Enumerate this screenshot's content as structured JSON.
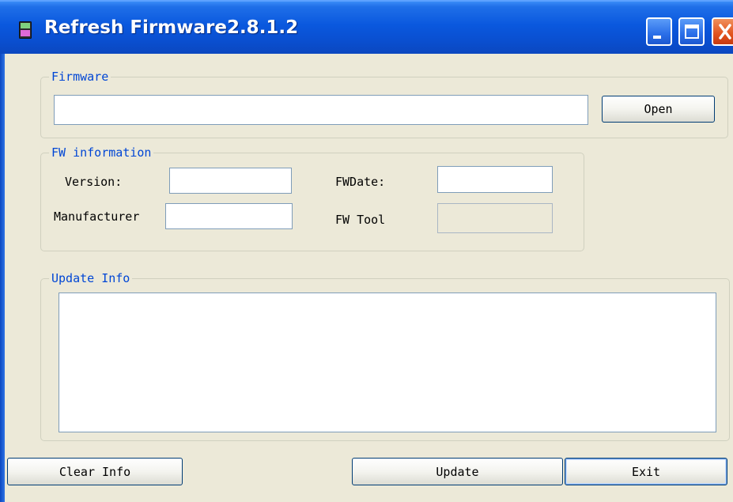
{
  "window": {
    "title": "Refresh Firmware2.8.1.2"
  },
  "firmware": {
    "legend": "Firmware",
    "path": "",
    "open_label": "Open"
  },
  "fw_info": {
    "legend": "FW information",
    "version_label": "Version:",
    "fwdate_label": "FWDate:",
    "manufacturer_label": "Manufacturer",
    "fwtool_label": "FW Tool",
    "version": "",
    "fwdate": "",
    "manufacturer": "",
    "fwtool": ""
  },
  "update_info": {
    "legend": "Update Info",
    "text": ""
  },
  "buttons": {
    "clear": "Clear Info",
    "update": "Update",
    "exit": "Exit"
  },
  "icons": {
    "app": "firmware-device-icon",
    "minimize": "minimize-icon",
    "maximize": "maximize-icon",
    "close": "close-icon"
  },
  "colors": {
    "titlebar": "#0a58de",
    "legend": "#0046d5",
    "window_bg": "#ece9d8",
    "close": "#e2521d"
  }
}
